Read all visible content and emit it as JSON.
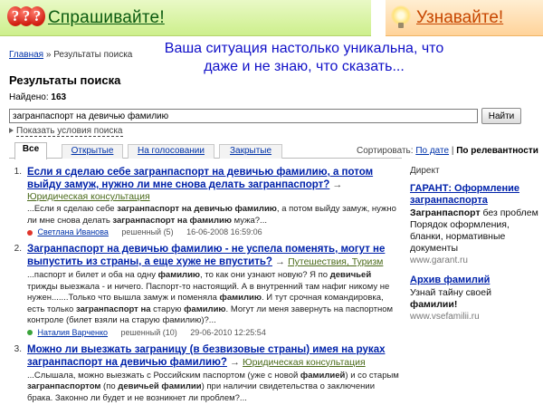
{
  "header": {
    "ask_logo": "???",
    "ask_title": "Спрашивайте!",
    "learn_title": "Узнавайте!"
  },
  "caption": "Ваша ситуация настолько уникальна, что даже и не знаю, что сказать...",
  "breadcrumb": {
    "home": "Главная",
    "separator": "»",
    "current": "Результаты поиска"
  },
  "page_title": "Результаты поиска",
  "found": {
    "label": "Найдено:",
    "count": "163"
  },
  "search": {
    "value": "загранпаспорт на девичью фамилию",
    "button": "Найти"
  },
  "toggle_conditions": "Показать условия поиска",
  "tabs": [
    {
      "label": "Все",
      "active": true
    },
    {
      "label": "Открытые",
      "active": false
    },
    {
      "label": "На голосовании",
      "active": false
    },
    {
      "label": "Закрытые",
      "active": false
    }
  ],
  "sort": {
    "label": "Сортировать:",
    "by_date": "По дате",
    "separator": "|",
    "by_relevance": "По релевантности"
  },
  "results": [
    {
      "num": "1.",
      "title": "Если я сделаю себе загранпаспорт на девичью фамилию, а потом выйду замуж, нужно ли мне снова делать загранпаспорт?",
      "arrow": "→",
      "category": "Юридическая консультация",
      "snippet": "...Если я сделаю себе загранпаспорт на девичью фамилию, а потом выйду замуж, нужно ли мне снова делать загранпаспорт на фамилию мужа?...",
      "user": "Светлана Иванова",
      "status": "решенный (5)",
      "date": "16-06-2008 16:59:06",
      "dot_color": "#e0352b"
    },
    {
      "num": "2.",
      "title": "Загранпаспорт на девичью фамилию - не успела поменять, могут не выпустить из страны, а еще хуже не впустить?",
      "arrow": "→",
      "category": "Путешествия, Туризм",
      "snippet": "...паспорт и билет и оба на одну фамилию, то как они узнают новую? Я по девичьей трижды выезжала - и ничего. Паспорт-то настоящий. А в внутренний там нафиг никому не нужен.......Только что вышла замуж и поменяла фамилию. И тут срочная командировка, есть только загранпаспорт на старую фамилию. Могут ли меня завернуть на паспортном контроле (билет взяли на старую фамилию)?...",
      "user": "Наталия Варченко",
      "status": "решенный (10)",
      "date": "29-06-2010 12:25:54",
      "dot_color": "#3aa33a"
    },
    {
      "num": "3.",
      "title": "Можно ли выезжать заграницу (в безвизовые страны) имея на руках загранпаспорт на девичью фамилию?",
      "arrow": "→",
      "category": "Юридическая консультация",
      "snippet": "...Слышала, можно выезжать с Российским паспортом (уже с новой фамилией) и со старым загранпаспортом (по девичьей фамилии) при наличии свидетельства о заключении брака. Законно ли будет и не возникнет ли проблем?...",
      "user": "",
      "status": "",
      "date": "",
      "dot_color": "#3aa33a"
    }
  ],
  "sidebar": {
    "label": "Директ",
    "ads": [
      {
        "title": "ГАРАНТ: Оформление загранпаспорта",
        "text": "Загранпаспорт без проблем Порядок оформления, бланки, нормативные документы",
        "url": "www.garant.ru"
      },
      {
        "title": "Архив фамилий",
        "text": "Узнай тайну своей фамилии!",
        "url": "www.vsefamilii.ru"
      }
    ]
  }
}
